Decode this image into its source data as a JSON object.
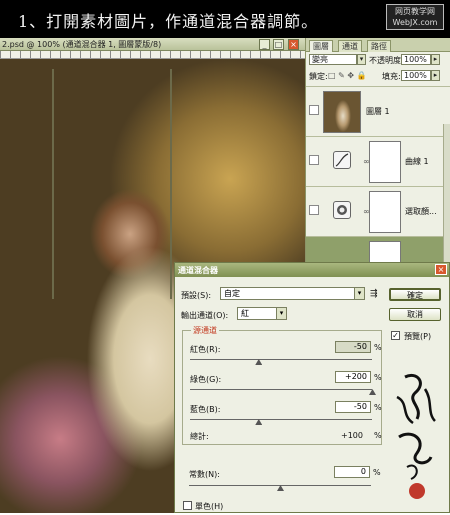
{
  "banner": {
    "text": "1、打開素材圖片，作通道混合器調節。",
    "watermark_line1": "网页教学网",
    "watermark_line2": "WebJX.com"
  },
  "document": {
    "title": "2.psd @ 100% (通道混合器 1, 圖層蒙版/8)",
    "buttons": {
      "minimize": "_",
      "maximize": "□",
      "close": "×"
    }
  },
  "layers_panel": {
    "tabs": [
      "圖層",
      "通道",
      "路徑"
    ],
    "blend_mode": "變亮",
    "opacity_label": "不透明度:",
    "opacity_value": "100%",
    "lock_label": "鎖定:",
    "fill_label": "填充:",
    "fill_value": "100%",
    "layers": [
      {
        "name": "圖層 1",
        "kind": "photo"
      },
      {
        "name": "曲線 1",
        "kind": "curves"
      },
      {
        "name": "選取顏...",
        "kind": "selective-color"
      }
    ]
  },
  "channel_mixer": {
    "title": "通道混合器",
    "preset_label": "預設(S):",
    "preset_value": "自定",
    "output_label": "輸出通道(O):",
    "output_value": "紅",
    "ok_label": "確定",
    "cancel_label": "取消",
    "preview_label": "預覽(P)",
    "preview_checked": true,
    "source_group_label": "源通道",
    "channels": [
      {
        "label": "紅色(R):",
        "value": "-50",
        "level": 0.375,
        "dim": true
      },
      {
        "label": "綠色(G):",
        "value": "+200",
        "level": 1.0,
        "dim": false
      },
      {
        "label": "藍色(B):",
        "value": "-50",
        "level": 0.375,
        "dim": false
      }
    ],
    "total_label": "總計:",
    "total_value": "+100",
    "constant_label": "常數(N):",
    "constant_value": "0",
    "constant_level": 0.5,
    "percent": "%",
    "mono_label": "單色(H)",
    "mono_checked": false
  },
  "signature": {
    "text": "歸林水心",
    "stamp_color": "#c0392b"
  }
}
